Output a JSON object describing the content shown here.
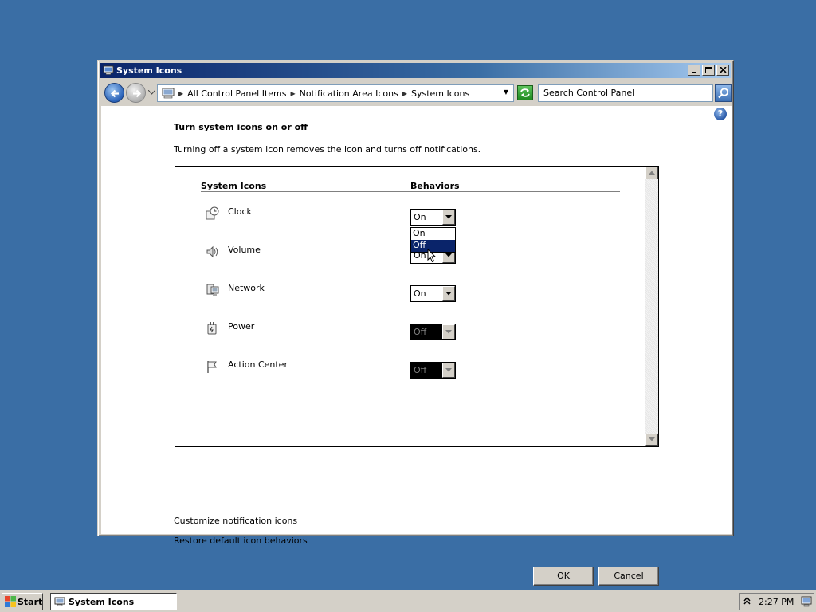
{
  "window": {
    "title": "System Icons"
  },
  "address": {
    "breadcrumbs": [
      "All Control Panel Items",
      "Notification Area Icons",
      "System Icons"
    ],
    "search_placeholder": "Search Control Panel"
  },
  "content": {
    "heading": "Turn system icons on or off",
    "description": "Turning off a system icon removes the icon and turns off notifications.",
    "columns": {
      "icons": "System Icons",
      "behaviors": "Behaviors"
    },
    "rows": [
      {
        "label": "Clock",
        "icon": "clock-icon",
        "value": "On",
        "disabled": false
      },
      {
        "label": "Volume",
        "icon": "volume-icon",
        "value": "On",
        "disabled": false
      },
      {
        "label": "Network",
        "icon": "network-icon",
        "value": "On",
        "disabled": false
      },
      {
        "label": "Power",
        "icon": "power-icon",
        "value": "Off",
        "disabled": true
      },
      {
        "label": "Action Center",
        "icon": "flag-icon",
        "value": "Off",
        "disabled": true
      }
    ],
    "open_dropdown": {
      "options": [
        "On",
        "Off"
      ],
      "highlighted": "Off"
    },
    "links": {
      "customize": "Customize notification icons",
      "restore": "Restore default icon behaviors"
    },
    "buttons": {
      "ok": "OK",
      "cancel": "Cancel"
    },
    "help_glyph": "?"
  },
  "taskbar": {
    "start_label": "Start",
    "task_label": "System Icons",
    "tray_up_glyph": "^",
    "time": "2:27 PM"
  },
  "colors": {
    "desktop": "#3a6ea5",
    "selection": "#0a246a",
    "face": "#d4d0c8"
  }
}
